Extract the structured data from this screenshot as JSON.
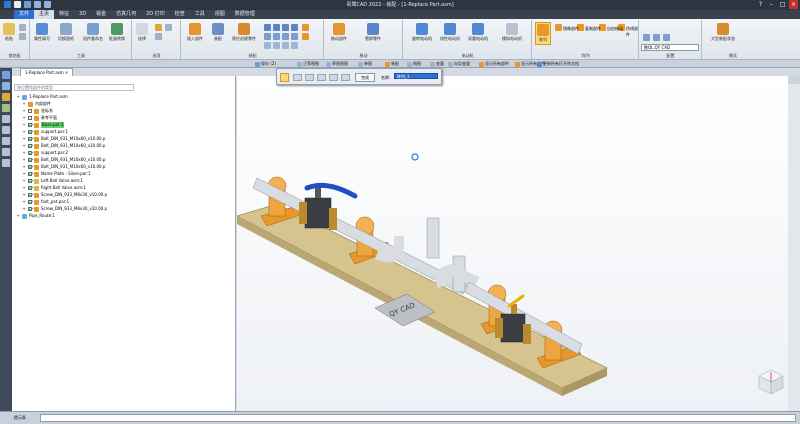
{
  "app": {
    "title": "青鹭CAD 2022 - 装配 - [1-Replace Part.asm]",
    "menu_tabs": [
      "文件",
      "主页",
      "特征",
      "3D",
      "钣金",
      "仿真几何",
      "2D 打印",
      "检查",
      "工具",
      "视图",
      "数据管理"
    ],
    "active_tab": "主页"
  },
  "ribbon": {
    "groups": [
      {
        "label": "剪贴板",
        "buttons": [
          "粘贴"
        ]
      },
      {
        "label": "工具",
        "buttons": [
          "属性填写",
          "切换图纸",
          "组件重命名",
          "批量转换"
        ]
      },
      {
        "label": "选项",
        "buttons": [
          "选择"
        ]
      },
      {
        "label": "装配",
        "buttons": [
          "插入部件",
          "装配",
          "原位创建零件"
        ]
      },
      {
        "label": "移动",
        "buttons": [
          "拖动部件",
          "替换零件"
        ]
      },
      {
        "label": "电动机",
        "buttons": [
          "旋转电动机",
          "线性电动机",
          "双重电动机",
          "模拟电动机"
        ]
      },
      {
        "label": "阵列",
        "buttons": [
          "阵列",
          "镜像部件",
          "复制部件",
          "自由移动",
          "伪线部件"
        ]
      },
      {
        "label": "配置",
        "buttons": []
      },
      {
        "label": "模式",
        "buttons": [
          "大型装配状态"
        ]
      }
    ],
    "search_value": "数QL.QY CAD"
  },
  "command_bar": {
    "items": [
      "保存 (2)",
      "正等视图",
      "草图视图",
      "单图",
      "装配",
      "侧图",
      "变量",
      "向导变量",
      "显示所有部件",
      "显示所有部件",
      "更新所有打开的文档"
    ]
  },
  "float_toolbar": {
    "finish_label": "完成",
    "name_label": "名称:",
    "name_value": "阵列_1"
  },
  "document_tab": "1-Replace Part.asm",
  "tree": {
    "filter_placeholder": "按位置找部件的类型",
    "items": [
      {
        "label": "1-Replace Part.asm",
        "level": 0,
        "checked": null,
        "selected": false
      },
      {
        "label": "内部部件",
        "level": 1,
        "checked": null,
        "selected": false
      },
      {
        "label": "坐标系",
        "level": 1,
        "checked": false,
        "selected": false
      },
      {
        "label": "参考平面",
        "level": 1,
        "checked": false,
        "selected": false
      },
      {
        "label": "Base.par:1",
        "level": 1,
        "checked": true,
        "selected": true
      },
      {
        "label": "support.par:1",
        "level": 1,
        "checked": true,
        "selected": false
      },
      {
        "label": "Bolt_DIN_931_M10x60_v10.00.p",
        "level": 1,
        "checked": true,
        "selected": false
      },
      {
        "label": "Bolt_DIN_931_M10x60_v10.00.p",
        "level": 1,
        "checked": true,
        "selected": false
      },
      {
        "label": "support.par:2",
        "level": 1,
        "checked": true,
        "selected": false
      },
      {
        "label": "Bolt_DIN_931_M10x60_v10.00.p",
        "level": 1,
        "checked": true,
        "selected": false
      },
      {
        "label": "Bolt_DIN_931_M10x60_v10.00.p",
        "level": 1,
        "checked": true,
        "selected": false
      },
      {
        "label": "Name Plate - Silver.par:1",
        "level": 1,
        "checked": true,
        "selected": false
      },
      {
        "label": "Left Ball Valve.asm:1",
        "level": 1,
        "checked": true,
        "selected": false
      },
      {
        "label": "Right Ball Valve.asm:1",
        "level": 1,
        "checked": true,
        "selected": false
      },
      {
        "label": "Screw_DIN_933_M8x30_v10.00.p",
        "level": 1,
        "checked": true,
        "selected": false
      },
      {
        "label": "foot_pot.par:1",
        "level": 1,
        "checked": true,
        "selected": false
      },
      {
        "label": "Screw_DIN_933_M8x30_v10.00.p",
        "level": 1,
        "checked": true,
        "selected": false
      },
      {
        "label": "Pipe_Route:1",
        "level": 0,
        "checked": null,
        "selected": false
      }
    ]
  },
  "viewport": {
    "name_plate_text": "QY CAD"
  },
  "status": {
    "prompt_label": "提示条"
  },
  "colors": {
    "base_plate": "#d6c48f",
    "support": "#e8972a",
    "pipe": "#d9dde2",
    "valve_handle": "#1f4fc4",
    "valve_body": "#3a3d42",
    "brass": "#b98a2e",
    "accent": "#2e6fd8"
  }
}
